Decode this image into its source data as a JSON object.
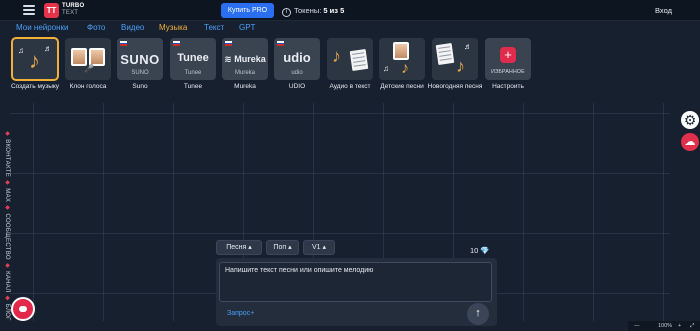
{
  "header": {
    "logo_letters": "TT",
    "logo_title": "TURBO",
    "logo_subtitle": "TEXT",
    "buy_pro_label": "Купить PRO",
    "tokens_label": "Токены:",
    "tokens_value": "5 из 5",
    "login_label": "Вход"
  },
  "nav": {
    "tabs": [
      {
        "label": "Мои нейронки",
        "active": false
      },
      {
        "label": "Фото",
        "active": false
      },
      {
        "label": "Видео",
        "active": false
      },
      {
        "label": "Музыка",
        "active": true
      },
      {
        "label": "Текст",
        "active": false
      },
      {
        "label": "GPT",
        "active": false
      }
    ]
  },
  "tiles": [
    {
      "caption": "Создать музыку",
      "selected": true
    },
    {
      "caption": "Клон голоса",
      "selected": false
    },
    {
      "caption": "Suno",
      "brand": "SUNO",
      "brand_sub": "SUNO"
    },
    {
      "caption": "Tunee",
      "brand": "Tunee",
      "brand_sub": "Tunee"
    },
    {
      "caption": "Mureka",
      "brand": "Mureka",
      "brand_sub": "Mureka"
    },
    {
      "caption": "UDIO",
      "brand": "udio",
      "brand_sub": "udio"
    },
    {
      "caption": "Аудио в текст"
    },
    {
      "caption": "Детские песни"
    },
    {
      "caption": "Новогодняя песня"
    },
    {
      "caption": "Настроить",
      "inner_label": "ИЗБРАННОЕ"
    }
  ],
  "side_links": {
    "items": [
      "ВКОНТАКТЕ",
      "MAX",
      "СООБЩЕСТВО",
      "КАНАЛ",
      "БЛОГ"
    ]
  },
  "prompt": {
    "genre_label": "Песня",
    "style_label": "Поп",
    "version_label": "V1",
    "credits_value": "10",
    "placeholder": "Напишите текст песни или опишите мелодию",
    "query_link": "Запрос+"
  },
  "zoom": {
    "value": "100%"
  },
  "colors": {
    "accent_blue": "#2a6ff2",
    "accent_gold": "#f0b13a",
    "brand_red": "#e5334c",
    "background": "#17202f"
  }
}
